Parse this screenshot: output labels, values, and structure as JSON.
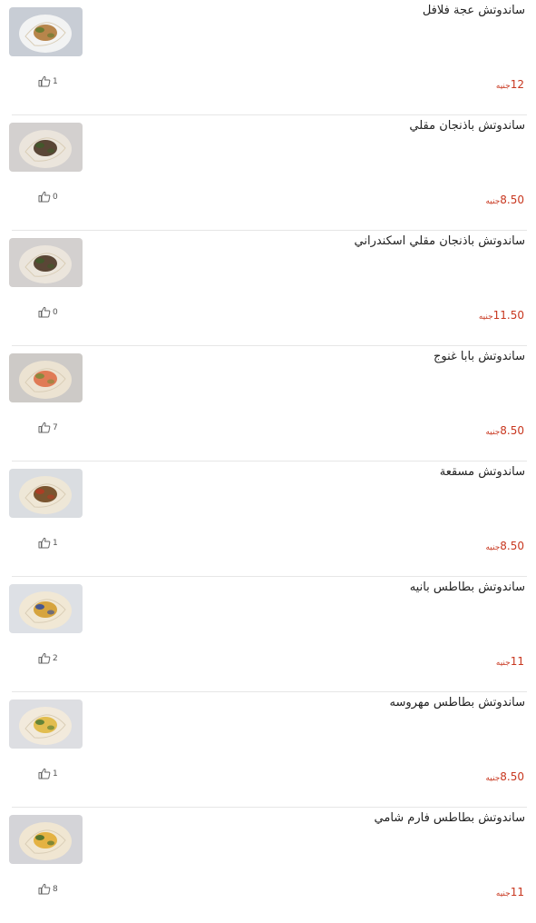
{
  "currency": "جنيه",
  "items": [
    {
      "name": "ساندوتش عجة فلافل",
      "price": "12",
      "likes": "1",
      "image": "falafel-omelette-sandwich-image",
      "bg": "#c8cdd5",
      "plate": "#f4f4f4",
      "food": "#b7854b",
      "accent": "#5d7a2e"
    },
    {
      "name": "ساندوتش باذنجان مقلي",
      "price": "8.50",
      "likes": "0",
      "image": "fried-eggplant-sandwich-image",
      "bg": "#d3d0cf",
      "plate": "#ece6dc",
      "food": "#5a4636",
      "accent": "#3f5a2a"
    },
    {
      "name": "ساندوتش باذنجان مقلي اسكندراني",
      "price": "11.50",
      "likes": "0",
      "image": "alexandrian-fried-eggplant-sandwich-image",
      "bg": "#d3d0cf",
      "plate": "#ece6dc",
      "food": "#5a4636",
      "accent": "#3f5a2a"
    },
    {
      "name": "ساندوتش بابا غنوج",
      "price": "8.50",
      "likes": "7",
      "image": "baba-ghanoush-sandwich-image",
      "bg": "#cdcac7",
      "plate": "#ede4d3",
      "food": "#e07b56",
      "accent": "#7a8c3a"
    },
    {
      "name": "ساندوتش مسقعة",
      "price": "8.50",
      "likes": "1",
      "image": "moussaka-sandwich-image",
      "bg": "#dadde1",
      "plate": "#efe7d6",
      "food": "#7a5530",
      "accent": "#b53b23"
    },
    {
      "name": "ساندوتش بطاطس بانيه",
      "price": "11",
      "likes": "2",
      "image": "breaded-potato-sandwich-image",
      "bg": "#dde0e5",
      "plate": "#f1e8d4",
      "food": "#d6a43e",
      "accent": "#2c4aa0"
    },
    {
      "name": "ساندوتش بطاطس مهروسه",
      "price": "8.50",
      "likes": "1",
      "image": "mashed-potato-sandwich-image",
      "bg": "#dddee2",
      "plate": "#f2eadb",
      "food": "#e2bd4f",
      "accent": "#4e7a34"
    },
    {
      "name": "ساندوتش بطاطس فارم شامي",
      "price": "11",
      "likes": "8",
      "image": "french-fries-shami-sandwich-image",
      "bg": "#d4d4d8",
      "plate": "#f1e7d2",
      "food": "#e4b243",
      "accent": "#3e6b2c"
    }
  ]
}
